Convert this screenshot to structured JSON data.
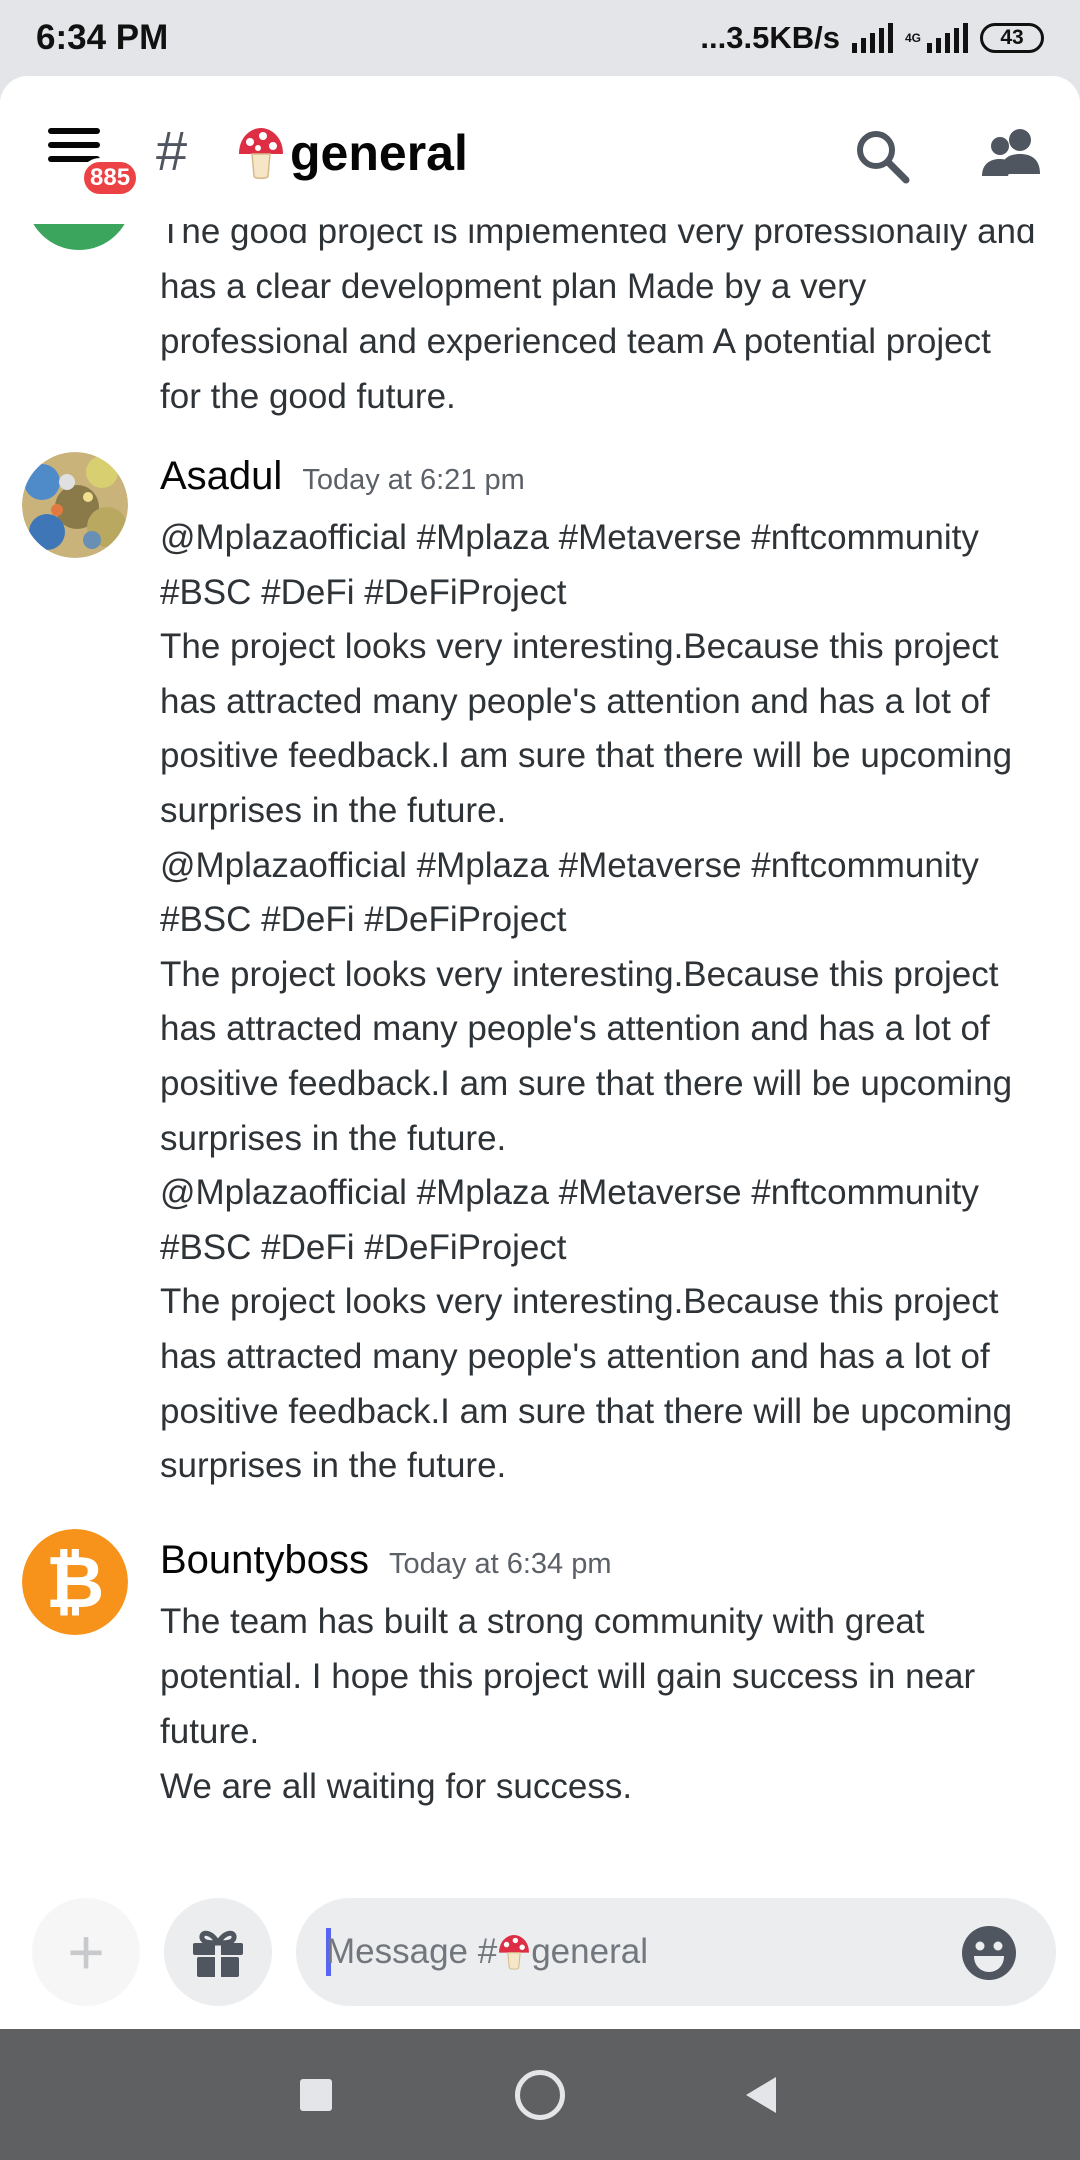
{
  "status_bar": {
    "time": "6:34 PM",
    "network_speed": "...3.5KB/s",
    "network_type": "4G",
    "battery": "43"
  },
  "header": {
    "unread_count": "885",
    "channel_prefix": "#",
    "channel_name": "general",
    "channel_icon": "mushroom-emoji",
    "actions": [
      "search-icon",
      "members-icon"
    ]
  },
  "messages": [
    {
      "id": "partial",
      "lines": [
        "The good project is implemented very professionally and",
        "has a clear development plan Made by a very",
        "professional and experienced team A potential project",
        "for the good future."
      ]
    },
    {
      "id": "asadul",
      "username": "Asadul",
      "timestamp": "Today at 6:21 pm",
      "lines": [
        "@Mplazaofficial #Mplaza #Metaverse #nftcommunity",
        "#BSC  #DeFi #DeFiProject",
        "The project looks very interesting.Because this project",
        "has attracted many people's attention and has a lot of",
        "positive feedback.I am sure that there will be upcoming",
        "surprises in the future.",
        "@Mplazaofficial #Mplaza #Metaverse #nftcommunity",
        "#BSC  #DeFi #DeFiProject",
        "The project looks very interesting.Because this project",
        "has attracted many people's attention and has a lot of",
        "positive feedback.I am sure that there will be upcoming",
        "surprises in the future.",
        "@Mplazaofficial #Mplaza #Metaverse #nftcommunity",
        "#BSC  #DeFi #DeFiProject",
        "The project looks very interesting.Because this project",
        "has attracted many people's attention and has a lot of",
        "positive feedback.I am sure that there will be upcoming",
        "surprises in the future."
      ]
    },
    {
      "id": "bountyboss",
      "username": "Bountyboss",
      "timestamp": "Today at 6:34 pm",
      "lines": [
        "The team has built a strong community with great",
        "potential. I hope this project will gain success in near",
        "future.",
        "We are all waiting for success."
      ]
    }
  ],
  "composer": {
    "placeholder_prefix": "Message #",
    "placeholder_channel": "general",
    "plus_label": "+",
    "buttons": [
      "plus-icon",
      "gift-icon",
      "emoji-icon"
    ]
  },
  "navbar": [
    "recents-icon",
    "home-icon",
    "back-icon"
  ],
  "colors": {
    "unread_badge": "#ed4245",
    "caret": "#5865f2",
    "bitcoin_avatar": "#f7931a",
    "partial_avatar": "#3ba55d"
  }
}
